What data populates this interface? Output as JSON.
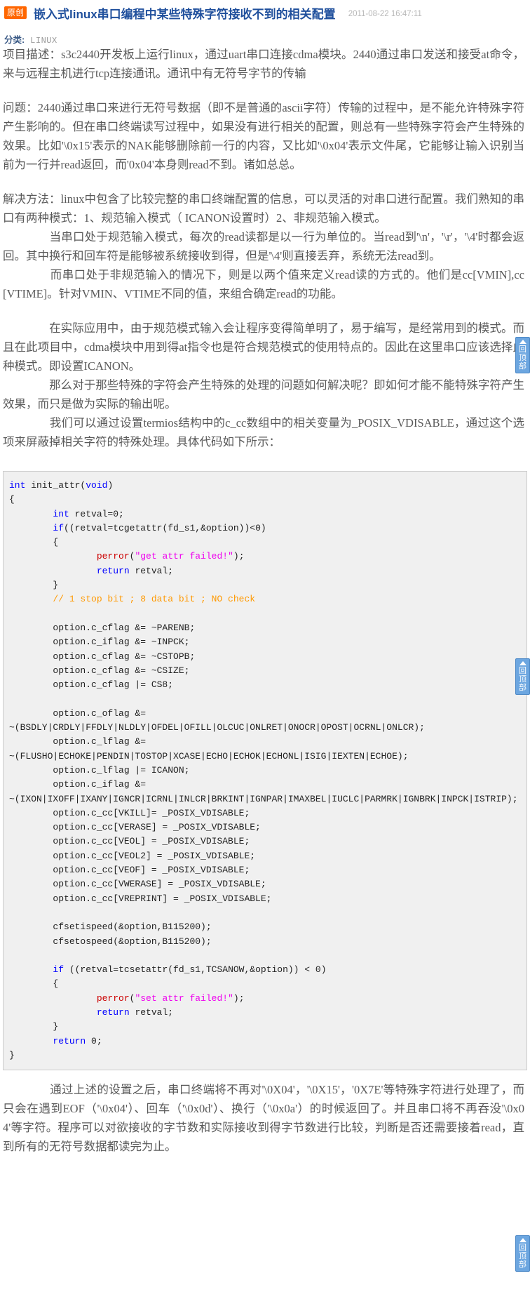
{
  "header": {
    "badge": "原创",
    "title": "嵌入式linux串口编程中某些特殊字符接收不到的相关配置",
    "timestamp": "2011-08-22 16:47:11"
  },
  "category": {
    "label": "分类:",
    "value": "LINUX"
  },
  "article": {
    "p1": "项目描述：s3c2440开发板上运行linux，通过uart串口连接cdma模块。2440通过串口发送和接受at命令，来与远程主机进行tcp连接通讯。通讯中有无符号字节的传输",
    "p2": "问题：2440通过串口来进行无符号数据（即不是普通的ascii字符）传输的过程中，是不能允许特殊字符产生影响的。但在串口终端读写过程中，如果没有进行相关的配置，则总有一些特殊字符会产生特殊的效果。比如'\\0x15'表示的NAK能够删除前一行的内容，又比如'\\0x04'表示文件尾，它能够让输入识别当前为一行并read返回，而'0x04'本身则read不到。诸如总总。",
    "p3": "解决方法：linux中包含了比较完整的串口终端配置的信息，可以灵活的对串口进行配置。我们熟知的串口有两种模式：1、规范输入模式（ ICANON设置时）2、非规范输入模式。",
    "p4": "当串口处于规范输入模式，每次的read读都是以一行为单位的。当read到'\\n'，'\\r'，'\\4'时都会返回。其中换行和回车符是能够被系统接收到得，但是'\\4'则直接丢弃，系统无法read到。",
    "p5": "而串口处于非规范输入的情况下，则是以两个值来定义read读的方式的。他们是cc[VMIN],cc[VTIME]。针对VMIN、VTIME不同的值，来组合确定read的功能。",
    "p6": "在实际应用中，由于规范模式输入会让程序变得简单明了，易于编写，是经常用到的模式。而且在此项目中，cdma模块中用到得at指令也是符合规范模式的使用特点的。因此在这里串口应该选择此种模式。即设置ICANON。",
    "p7": "那么对于那些特殊的字符会产生特殊的处理的问题如何解决呢？即如何才能不能特殊字符产生效果，而只是做为实际的输出呢。",
    "p8": "我们可以通过设置termios结构中的c_cc数组中的相关变量为_POSIX_VDISABLE，通过这个选项来屏蔽掉相关字符的特殊处理。具体代码如下所示：",
    "p9": "通过上述的设置之后，串口终端将不再对'\\0X04'，'\\0X15'，'0X7E'等特殊字符进行处理了，而只会在遇到EOF（'\\0x04'）、回车（'\\0x0d'）、换行（'\\0x0a'）的时候返回了。并且串口将不再吞没'\\0x04'等字符。程序可以对欲接收的字节数和实际接收到得字节数进行比较，判断是否还需要接着read，直到所有的无符号数据都读完为止。"
  },
  "code": {
    "language": "c",
    "lines": [
      "int init_attr(void)",
      "{",
      "        int retval=0;",
      "        if((retval=tcgetattr(fd_s1,&option))<0)",
      "        {",
      "                perror(\"get attr failed!\");",
      "                return retval;",
      "        }",
      "        // 1 stop bit ; 8 data bit ; NO check",
      "",
      "        option.c_cflag &= ~PARENB;",
      "        option.c_iflag &= ~INPCK;",
      "        option.c_cflag &= ~CSTOPB;",
      "        option.c_cflag &= ~CSIZE;",
      "        option.c_cflag |= CS8;",
      "",
      "        option.c_oflag &=",
      "~(BSDLY|CRDLY|FFDLY|NLDLY|OFDEL|OFILL|OLCUC|ONLRET|ONOCR|OPOST|OCRNL|ONLCR);",
      "        option.c_lflag &=",
      "~(FLUSHO|ECHOKE|PENDIN|TOSTOP|XCASE|ECHO|ECHOK|ECHONL|ISIG|IEXTEN|ECHOE);",
      "        option.c_lflag |= ICANON;",
      "        option.c_iflag &=",
      "~(IXON|IXOFF|IXANY|IGNCR|ICRNL|INLCR|BRKINT|IGNPAR|IMAXBEL|IUCLC|PARMRK|IGNBRK|INPCK|ISTRIP);",
      "        option.c_cc[VKILL]= _POSIX_VDISABLE;",
      "        option.c_cc[VERASE] = _POSIX_VDISABLE;",
      "        option.c_cc[VEOL] = _POSIX_VDISABLE;",
      "        option.c_cc[VEOL2] = _POSIX_VDISABLE;",
      "        option.c_cc[VEOF] = _POSIX_VDISABLE;",
      "        option.c_cc[VWERASE] = _POSIX_VDISABLE;",
      "        option.c_cc[VREPRINT] = _POSIX_VDISABLE;",
      "",
      "        cfsetispeed(&option,B115200);",
      "        cfsetospeed(&option,B115200);",
      "",
      "        if ((retval=tcsetattr(fd_s1,TCSANOW,&option)) < 0)",
      "        {",
      "                perror(\"set attr failed!\");",
      "                return retval;",
      "        }",
      "        return 0;",
      "}"
    ]
  },
  "back_to_top": {
    "chars": [
      "回",
      "顶",
      "部"
    ],
    "label": "回到顶部"
  },
  "colors": {
    "badge_bg": "#ff6600",
    "title": "#1f4f9c",
    "timestamp": "#b8b8b8",
    "body_text": "#595959",
    "code_bg": "#f0f0f0",
    "code_border": "#cccccc",
    "keyword": "#0000ff",
    "string": "#ee00ee",
    "comment": "#ff9900",
    "function": "#cc0000",
    "to_top_bg": "#6ca6e0"
  }
}
